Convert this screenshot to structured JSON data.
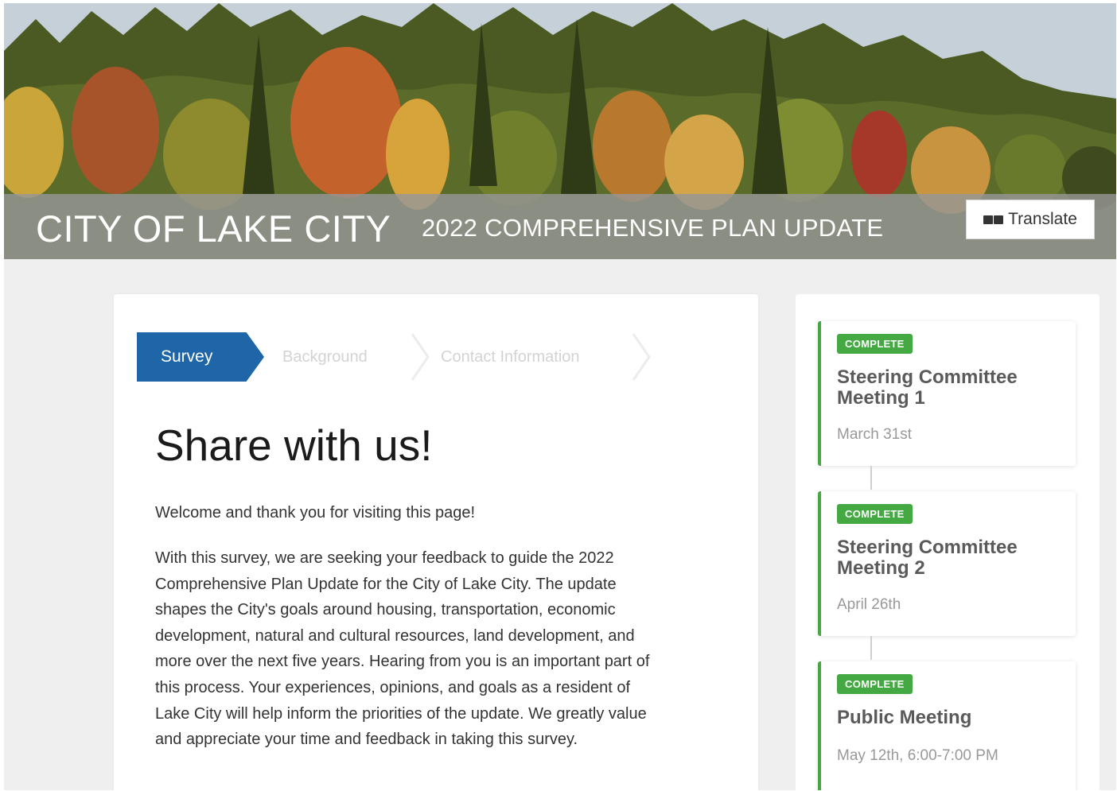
{
  "header": {
    "site_title": "CITY OF LAKE CITY",
    "site_subtitle": "2022 COMPREHENSIVE PLAN UPDATE",
    "translate_label": "Translate"
  },
  "stepper": {
    "steps": [
      {
        "label": "Survey",
        "state": "active"
      },
      {
        "label": "Background",
        "state": "inactive"
      },
      {
        "label": "Contact Information",
        "state": "inactive"
      }
    ]
  },
  "content": {
    "heading": "Share with us!",
    "welcome": "Welcome and thank you for visiting this page!",
    "body_lines": [
      "With this survey, we are seeking your feedback to guide the 2022",
      "Comprehensive Plan Update for the City of Lake City. The update",
      "shapes the City's goals around housing, transportation, economic",
      "development, natural and cultural resources, land development, and",
      "more over the next five years. Hearing from you is an important part of",
      "this process. Your experiences, opinions, and goals as a resident of",
      "Lake City will help inform the priorities of the update. We greatly value",
      "and appreciate your time and feedback in taking this survey."
    ]
  },
  "timeline": {
    "items": [
      {
        "status": "COMPLETE",
        "title": "Steering Committee Meeting 1",
        "date": "March 31st"
      },
      {
        "status": "COMPLETE",
        "title": "Steering Committee Meeting 2",
        "date": "April 26th"
      },
      {
        "status": "COMPLETE",
        "title": "Public Meeting",
        "date": "May 12th, 6:00-7:00 PM"
      }
    ]
  },
  "colors": {
    "primary": "#1f66a9",
    "complete": "#45a943",
    "page_bg": "#efefef"
  }
}
